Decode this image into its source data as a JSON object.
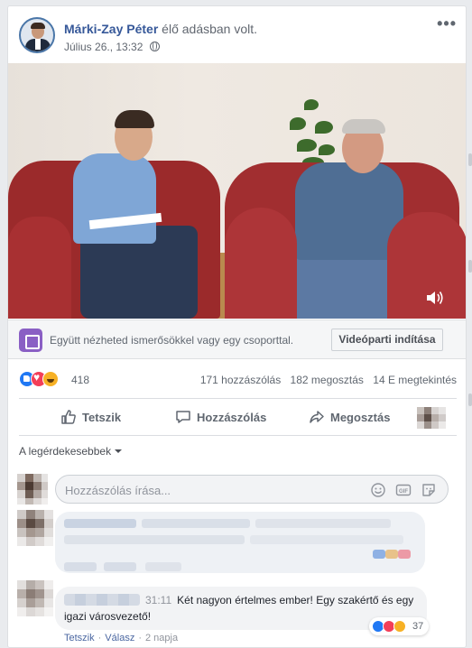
{
  "post": {
    "author_name": "Márki-Zay Péter",
    "action_text": "élő adásban volt.",
    "timestamp": "Július 26., 13:32",
    "privacy_icon": "globe-icon",
    "more_label": "•••"
  },
  "watch_party": {
    "description": "Együtt nézheted ismerősökkel vagy egy csoporttal.",
    "button_label": "Videóparti indítása"
  },
  "reactions": {
    "icons": [
      "like-icon",
      "love-icon",
      "haha-icon"
    ],
    "count": "418"
  },
  "stats": {
    "comments": "171 hozzászólás",
    "shares": "182 megosztás",
    "views": "14 E megtekintés"
  },
  "actions": {
    "like": "Tetszik",
    "comment": "Hozzászólás",
    "share": "Megosztás"
  },
  "sort": {
    "label": "A legérdekesebbek"
  },
  "comment_box": {
    "placeholder": "Hozzászólás írása..."
  },
  "comments": [
    {
      "timestamp": "31:11",
      "text": "Két nagyon értelmes ember! Egy szakértő és egy igazi városvezető!",
      "like_link": "Tetszik",
      "reply_link": "Válasz",
      "age": "2 napja",
      "reaction_count": "37"
    }
  ],
  "colors": {
    "link_blue": "#365899",
    "like_blue": "#2078f4",
    "love_red": "#f33e58",
    "haha_yellow": "#f7b125",
    "chair_red": "#9b2a2b"
  }
}
